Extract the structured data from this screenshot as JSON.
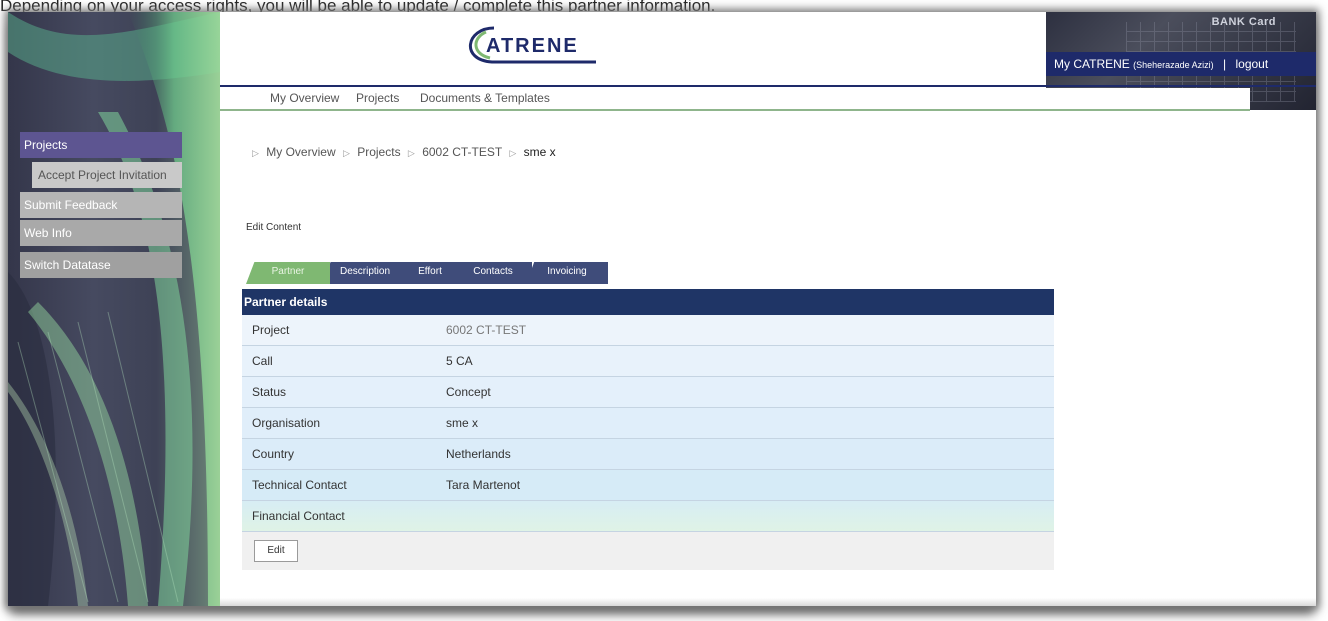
{
  "caption": "Depending on your access rights, you will be able to update / complete this partner information.",
  "header": {
    "logo_text": "ATRENE",
    "bank_card": "BANK Card",
    "user_label": "My CATRENE",
    "user_name": "(Sheherazade Azizi)",
    "separator": "|",
    "logout": "logout"
  },
  "nav": {
    "items": [
      "My Overview",
      "Projects",
      "Documents & Templates"
    ]
  },
  "sidebar": {
    "items": [
      {
        "label": "Projects"
      },
      {
        "label": "Accept Project Invitation"
      },
      {
        "label": "Submit Feedback"
      },
      {
        "label": "Web Info"
      },
      {
        "label": "Switch Datatase"
      }
    ]
  },
  "breadcrumb": {
    "items": [
      "My Overview",
      "Projects",
      "6002 CT-TEST"
    ],
    "current": "sme x"
  },
  "edit_content_label": "Edit Content",
  "tabs": [
    "Partner",
    "Description",
    "Effort",
    "Contacts",
    "Invoicing"
  ],
  "partner_details": {
    "title": "Partner details",
    "rows": [
      {
        "label": "Project",
        "value": "6002 CT-TEST"
      },
      {
        "label": "Call",
        "value": "5 CA"
      },
      {
        "label": "Status",
        "value": "Concept"
      },
      {
        "label": "Organisation",
        "value": "sme x"
      },
      {
        "label": "Country",
        "value": "Netherlands"
      },
      {
        "label": "Technical Contact",
        "value": "Tara Martenot"
      },
      {
        "label": "Financial Contact",
        "value": ""
      }
    ],
    "edit_button": "Edit"
  },
  "colors": {
    "header_blue": "#1e2a6a",
    "table_head": "#1f3566",
    "active_tab": "#7fb872",
    "menu_active": "#5d5591"
  }
}
